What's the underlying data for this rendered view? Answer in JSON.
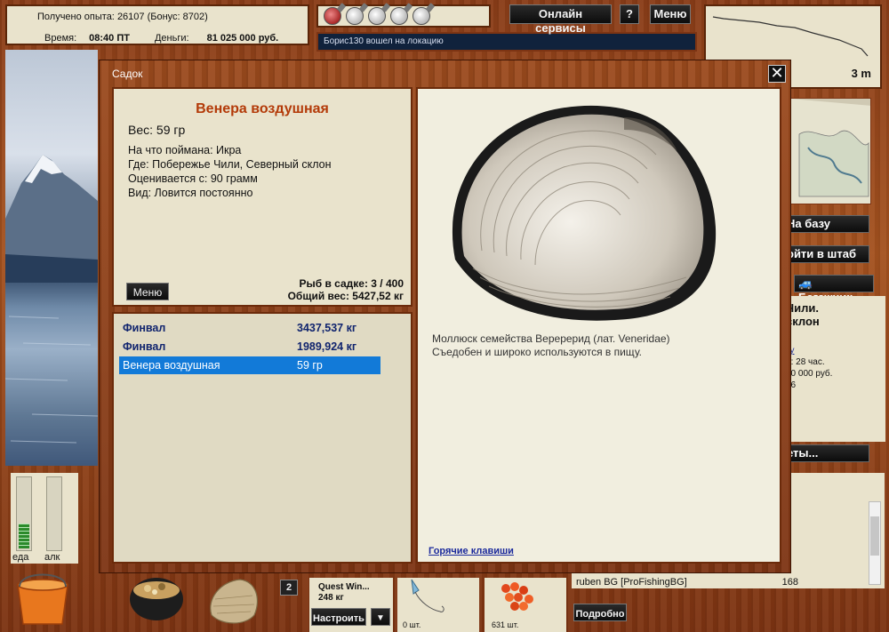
{
  "status": {
    "experience_label": "Получено опыта:",
    "experience_value": "26107",
    "bonus": "(Бонус: 8702)",
    "time_label": "Время:",
    "time_value": "08:40 ПТ",
    "money_label": "Деньги:",
    "money_value": "81 025 000 руб."
  },
  "flasks": {
    "total": 5,
    "filled": 1
  },
  "location_message": "Борис130 вошел на локацию",
  "top_buttons": {
    "online": "Онлайн сервисы",
    "help": "?",
    "menu": "Меню"
  },
  "depth": {
    "value": "3 m"
  },
  "right_panel": {
    "to_base": "На базу",
    "to_hq": "ойти в штаб",
    "trunk": "Багажник",
    "location_line1": "Чили.",
    "location_line2": "склон",
    "link_text": "ку",
    "line_a": "и: 28 час.",
    "line_b": "00 000 руб.",
    "line_c": "26",
    "more_button": "еты..."
  },
  "chat": {
    "last_user": "ruben BG [ProFishingBG]",
    "last_value": "168"
  },
  "bottom_buttons": {
    "detail": "Подробно",
    "setup": "Настроить",
    "dropdown": "▼"
  },
  "meters": {
    "food": {
      "label": "еда",
      "level_pct": 34
    },
    "alcohol": {
      "label": "алк",
      "level_pct": 0
    }
  },
  "quantity_badge": "2",
  "slots": {
    "rod_name": "Quest Win...",
    "rod_load": "248 кг",
    "hook_qty": "0 шт.",
    "bait_qty": "631 шт."
  },
  "modal": {
    "title": "Садок",
    "close": "✕",
    "fish_name": "Венера воздушная",
    "weight": "Вес: 59 гр",
    "caught_on": "На что поймана: Икра",
    "where": "Где: Побережье Чили, Северный склон",
    "price": "Оценивается с: 90 грамм",
    "kind": "Вид: Ловится постоянно",
    "menu_button": "Меню",
    "keepnet_count": "Рыб в садке: 3 / 400",
    "total_weight": "Общий вес: 5427,52 кг",
    "fish_list": [
      {
        "name": "Финвал",
        "weight": "3437,537 кг",
        "selected": false
      },
      {
        "name": "Финвал",
        "weight": "1989,924 кг",
        "selected": false
      },
      {
        "name": "Венера воздушная",
        "weight": "59 гр",
        "selected": true
      }
    ],
    "description_line1": "Моллюск семейства Веререрид (лат. Veneridae)",
    "description_line2": "Съедобен и широко используются в пищу.",
    "hotkeys": "Горячие клавиши"
  },
  "colors": {
    "title_orange": "#b33a08",
    "selected_row": "#127ad8",
    "link_blue": "#1b2a9c"
  }
}
